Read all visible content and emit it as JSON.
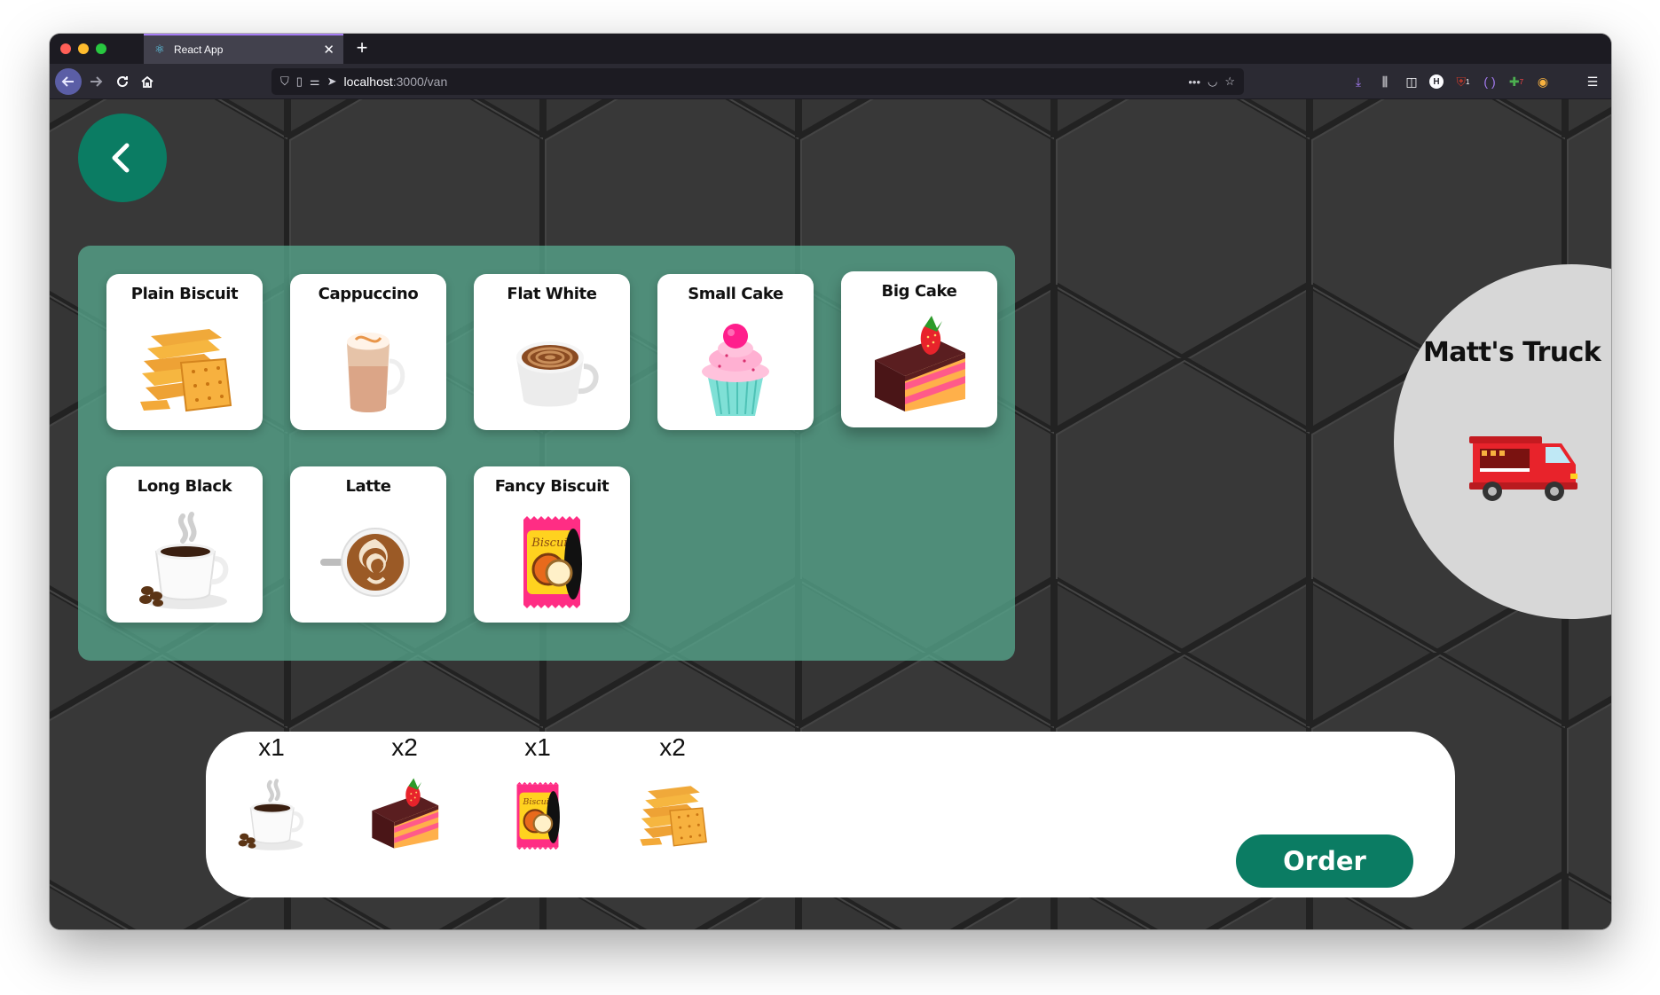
{
  "browser": {
    "tab_title": "React App",
    "url_host": "localhost",
    "url_path": ":3000/van",
    "extension_badges": [
      "1",
      "7"
    ]
  },
  "menu": {
    "items": [
      {
        "label": "Plain Biscuit",
        "icon": "plain-biscuit-icon"
      },
      {
        "label": "Cappuccino",
        "icon": "cappuccino-icon"
      },
      {
        "label": "Flat White",
        "icon": "flat-white-icon"
      },
      {
        "label": "Small Cake",
        "icon": "small-cake-icon"
      },
      {
        "label": "Big Cake",
        "icon": "big-cake-icon"
      },
      {
        "label": "Long Black",
        "icon": "long-black-icon"
      },
      {
        "label": "Latte",
        "icon": "latte-icon"
      },
      {
        "label": "Fancy Biscuit",
        "icon": "fancy-biscuit-icon"
      }
    ]
  },
  "van": {
    "name": "Matt's Truck",
    "icon": "food-truck-icon"
  },
  "cart": {
    "items": [
      {
        "qty": "x1",
        "icon": "long-black-icon"
      },
      {
        "qty": "x2",
        "icon": "big-cake-icon"
      },
      {
        "qty": "x1",
        "icon": "fancy-biscuit-icon"
      },
      {
        "qty": "x2",
        "icon": "plain-biscuit-icon"
      }
    ],
    "order_label": "Order"
  },
  "colors": {
    "accent": "#0b7c63",
    "panel": "#56a58c",
    "background": "#333333"
  }
}
